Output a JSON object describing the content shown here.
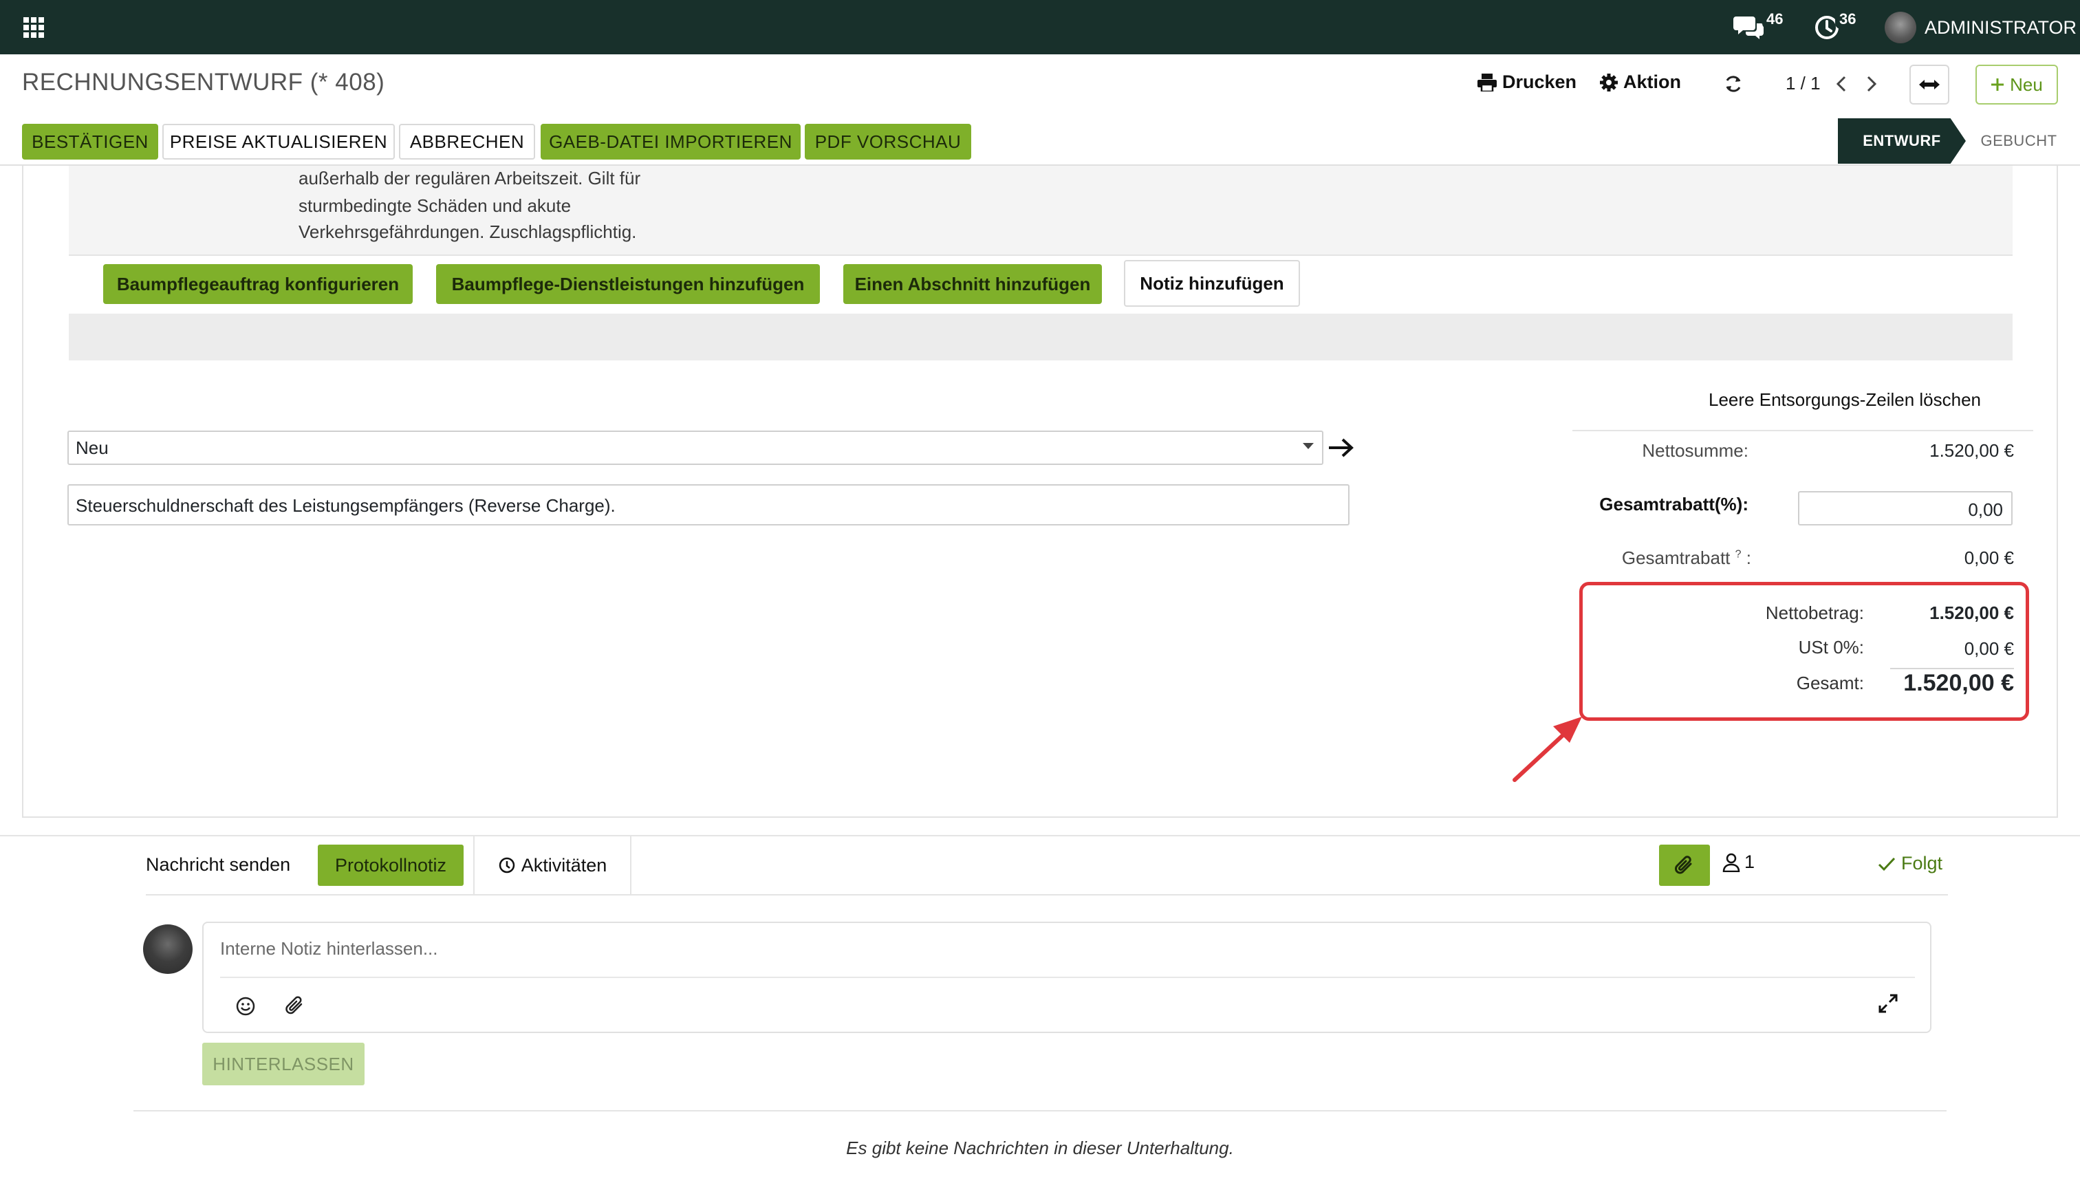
{
  "navbar": {
    "messages_count": "46",
    "activities_count": "36",
    "user_name": "ADMINISTRATOR"
  },
  "control_panel": {
    "breadcrumb": "RECHNUNGSENTWURF (* 408)",
    "print_label": "Drucken",
    "action_label": "Aktion",
    "pager": "1 / 1",
    "new_label": "Neu"
  },
  "header_buttons": {
    "confirm": "BESTÄTIGEN",
    "update_prices": "PREISE AKTUALISIEREN",
    "cancel": "ABBRECHEN",
    "import_gaeb": "GAEB-DATEI IMPORTIEREN",
    "pdf_preview": "PDF VORSCHAU"
  },
  "statusbar": {
    "draft": "ENTWURF",
    "posted": "GEBUCHT"
  },
  "line_description": [
    "außerhalb der regulären Arbeitszeit. Gilt für",
    "sturmbedingte Schäden und akute",
    "Verkehrsgefährdungen. Zuschlagspflichtig."
  ],
  "line_actions": {
    "configure": "Baumpflegeauftrag konfigurieren",
    "add_services": "Baumpflege-Dienstleistungen hinzufügen",
    "add_section": "Einen Abschnitt hinzufügen",
    "add_note": "Notiz hinzufügen"
  },
  "form": {
    "clear_disposal_lines": "Leere Entsorgungs-Zeilen löschen",
    "terms_select_value": "Neu",
    "reverse_charge_note": "Steuerschuldnerschaft des Leistungsempfängers (Reverse Charge)."
  },
  "totals": {
    "net_sum_label": "Nettosumme:",
    "net_sum_value": "1.520,00 €",
    "discount_pct_label": "Gesamtrabatt(%):",
    "discount_pct_value": "0,00",
    "discount_label": "Gesamtrabatt",
    "discount_tooltip_mark": "?",
    "discount_suffix": ":",
    "discount_value": "0,00 €",
    "net_amount_label": "Nettobetrag:",
    "net_amount_value": "1.520,00 €",
    "vat_label": "USt 0%:",
    "vat_value": "0,00 €",
    "total_label": "Gesamt:",
    "total_value": "1.520,00 €"
  },
  "chatter": {
    "send_message": "Nachricht senden",
    "log_note": "Protokollnotiz",
    "activities": "Aktivitäten",
    "followers_count": "1",
    "follow_state": "Folgt",
    "composer_placeholder": "Interne Notiz hinterlassen...",
    "post_button": "HINTERLASSEN",
    "empty_message": "Es gibt keine Nachrichten in dieser Unterhaltung."
  },
  "colors": {
    "navbar": "#18302b",
    "accent_green": "#7fb02a",
    "highlight_red": "#e0373c"
  },
  "icons": [
    "apps-grid-icon",
    "chat-icon",
    "clock-icon",
    "printer-icon",
    "gear-icon",
    "refresh-icon",
    "chevron-left-icon",
    "chevron-right-icon",
    "expand-arrows-icon",
    "plus-icon",
    "arrow-right-icon",
    "paperclip-icon",
    "user-icon",
    "check-icon",
    "smiley-icon",
    "fullscreen-icon"
  ]
}
